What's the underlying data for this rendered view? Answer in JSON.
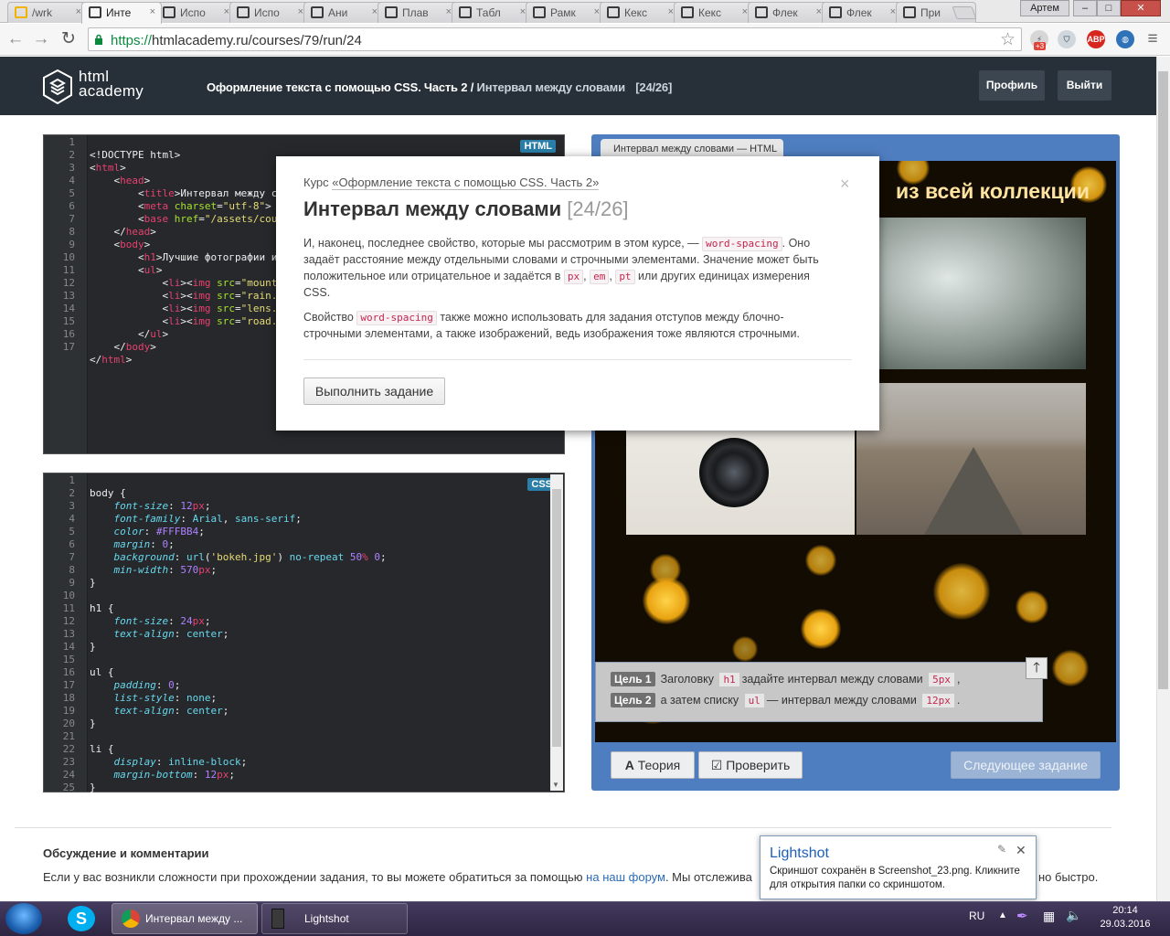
{
  "browser": {
    "tabs": [
      {
        "label": "/wrk"
      },
      {
        "label": "Инте"
      },
      {
        "label": "Испо"
      },
      {
        "label": "Испо"
      },
      {
        "label": "Ани"
      },
      {
        "label": "Плав"
      },
      {
        "label": "Табл"
      },
      {
        "label": "Рамк"
      },
      {
        "label": "Кекс"
      },
      {
        "label": "Кекс"
      },
      {
        "label": "Флек"
      },
      {
        "label": "Флек"
      },
      {
        "label": "При"
      }
    ],
    "user": "Артем",
    "url_scheme": "https://",
    "url_rest": "htmlacademy.ru/courses/79/run/24",
    "ext_badge": "+3",
    "abp": "ABP"
  },
  "header": {
    "logo_line1": "html",
    "logo_line2": "academy",
    "course": "Оформление текста с помощью CSS. Часть 2 /",
    "lesson": "Интервал между словами",
    "counter": "[24/26]",
    "profile": "Профиль",
    "logout": "Выйти"
  },
  "html_editor": {
    "badge": "HTML",
    "line_numbers": [
      "1",
      "2",
      "3",
      "4",
      "5",
      "6",
      "7",
      "8",
      "9",
      "10",
      "11",
      "12",
      "13",
      "14",
      "15",
      "16",
      "17"
    ]
  },
  "css_editor": {
    "badge": "CSS",
    "line_numbers": [
      "1",
      "2",
      "3",
      "4",
      "5",
      "6",
      "7",
      "8",
      "9",
      "10",
      "11",
      "12",
      "13",
      "14",
      "15",
      "16",
      "17",
      "18",
      "19",
      "20",
      "21",
      "22",
      "23",
      "24",
      "25"
    ]
  },
  "preview": {
    "tab_label": "Интервал между словами — HTML",
    "heading_visible": "из всей коллекции",
    "goals": [
      {
        "tag": "Цель 1",
        "before": "Заголовку",
        "code": "h1",
        "after": "задайте интервал между словами",
        "value": "5px",
        "end": ","
      },
      {
        "tag": "Цель 2",
        "before": "а затем списку",
        "code": "ul",
        "after": "— интервал между словами",
        "value": "12px",
        "end": "."
      }
    ],
    "theory": "Теория",
    "check": "Проверить",
    "next": "Следующее задание"
  },
  "modal": {
    "course_prefix": "Курс",
    "course_link": "«Оформление текста с помощью CSS. Часть 2»",
    "title": "Интервал между словами",
    "counter": "[24/26]",
    "close": "×",
    "p1_a": "И, наконец, последнее свойство, которые мы рассмотрим в этом курсе, —",
    "p1_code": "word-spacing",
    "p1_b": ". Оно",
    "p1_line2": "задаёт расстояние между отдельными словами и строчными элементами. Значение может быть",
    "p1_line3a": "положительное или отрицательное и задаётся в",
    "u1": "px",
    "u2": "em",
    "u3": "pt",
    "p1_line3b": "или других единицах измерения",
    "p1_line4": "CSS.",
    "p2_a": "Свойство",
    "p2_code": "word-spacing",
    "p2_b": "также можно использовать для задания отступов между блочно-",
    "p2_line2": "строчными элементами, а также изображений, ведь изображения тоже являются строчными.",
    "run_button": "Выполнить задание"
  },
  "discussion": {
    "title": "Обсуждение и комментарии",
    "text_a": "Если у вас возникли сложности при прохождении задания, то вы можете обратиться за помощью",
    "link": "на наш форум",
    "text_b": ". Мы отслежива",
    "tail": "но быстро."
  },
  "toast": {
    "title": "Lightshot",
    "body": "Скриншот сохранён в Screenshot_23.png. Кликните для открытия папки со скриншотом."
  },
  "taskbar": {
    "app1": "Интервал между ...",
    "app2": "Lightshot",
    "lang": "RU",
    "time": "20:14",
    "date": "29.03.2016"
  },
  "colors": {
    "header_bg": "#273038",
    "preview_frame": "#4f7ec0",
    "accent_link": "#2a6bb5"
  }
}
